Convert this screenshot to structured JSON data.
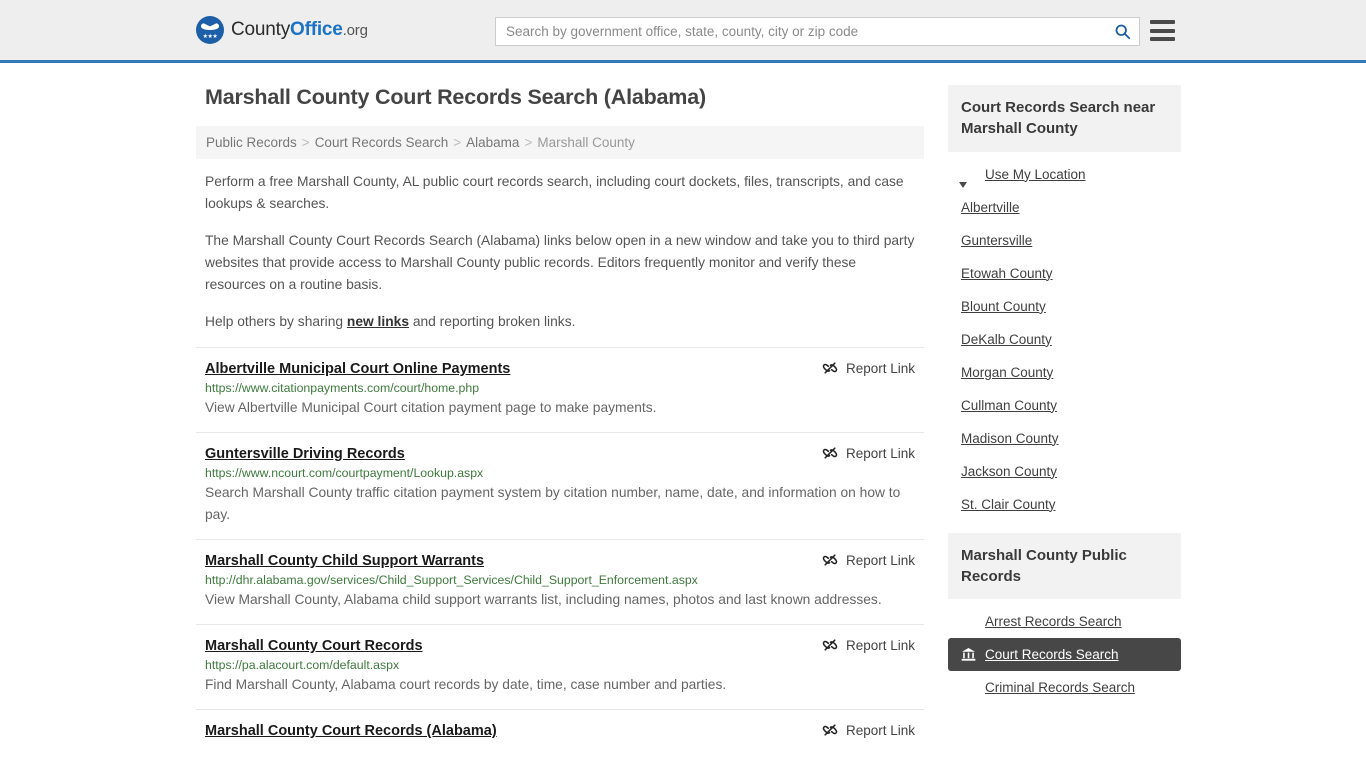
{
  "header": {
    "brand": {
      "county": "County",
      "office": "Office",
      "org": ".org"
    },
    "search": {
      "placeholder": "Search by government office, state, county, city or zip code",
      "value": ""
    },
    "icons": {
      "search": "search-icon",
      "menu": "hamburger-menu-icon"
    },
    "accent_color": "#337ab7"
  },
  "main": {
    "title": "Marshall County Court Records Search (Alabama)",
    "breadcrumb": [
      {
        "label": "Public Records",
        "current": false
      },
      {
        "label": "Court Records Search",
        "current": false
      },
      {
        "label": "Alabama",
        "current": false
      },
      {
        "label": "Marshall County",
        "current": true
      }
    ],
    "breadcrumb_separator": ">",
    "intro": [
      "Perform a free Marshall County, AL public court records search, including court dockets, files, transcripts, and case lookups & searches.",
      "The Marshall County Court Records Search (Alabama) links below open in a new window and take you to third party websites that provide access to Marshall County public records. Editors frequently monitor and verify these resources on a routine basis."
    ],
    "help_prefix": "Help others by sharing ",
    "help_link": "new links",
    "help_suffix": " and reporting broken links.",
    "report_label": "Report Link",
    "report_icon": "broken-link-icon",
    "links": [
      {
        "title": "Albertville Municipal Court Online Payments",
        "url": "https://www.citationpayments.com/court/home.php",
        "description": "View Albertville Municipal Court citation payment page to make payments."
      },
      {
        "title": "Guntersville Driving Records",
        "url": "https://www.ncourt.com/courtpayment/Lookup.aspx",
        "description": "Search Marshall County traffic citation payment system by citation number, name, date, and information on how to pay."
      },
      {
        "title": "Marshall County Child Support Warrants",
        "url": "http://dhr.alabama.gov/services/Child_Support_Services/Child_Support_Enforcement.aspx",
        "description": "View Marshall County, Alabama child support warrants list, including names, photos and last known addresses."
      },
      {
        "title": "Marshall County Court Records",
        "url": "https://pa.alacourt.com/default.aspx",
        "description": "Find Marshall County, Alabama court records by date, time, case number and parties."
      },
      {
        "title": "Marshall County Court Records (Alabama)",
        "url": "",
        "description": ""
      }
    ]
  },
  "sidebar": {
    "nearby": {
      "heading": "Court Records Search near Marshall County",
      "use_location": {
        "label": "Use My Location",
        "icon": "map-pin-icon"
      },
      "items": [
        {
          "label": "Albertville"
        },
        {
          "label": "Guntersville"
        },
        {
          "label": "Etowah County"
        },
        {
          "label": "Blount County"
        },
        {
          "label": "DeKalb County"
        },
        {
          "label": "Morgan County"
        },
        {
          "label": "Cullman County"
        },
        {
          "label": "Madison County"
        },
        {
          "label": "Jackson County"
        },
        {
          "label": "St. Clair County"
        }
      ]
    },
    "public_records": {
      "heading": "Marshall County Public Records",
      "items": [
        {
          "label": "Arrest Records Search",
          "icon": "square-icon",
          "active": false
        },
        {
          "label": "Court Records Search",
          "icon": "courthouse-icon",
          "active": true
        },
        {
          "label": "Criminal Records Search",
          "icon": "bar-icon",
          "active": false
        }
      ],
      "active_color": "#474747"
    }
  }
}
